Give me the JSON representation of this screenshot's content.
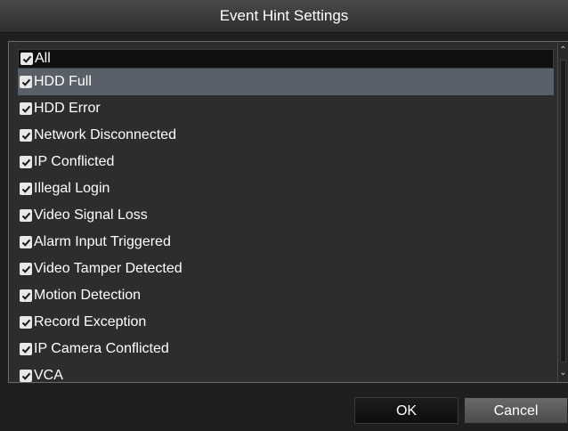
{
  "dialog": {
    "title": "Event Hint Settings"
  },
  "list": {
    "all_label": "All",
    "items": [
      {
        "label": "HDD Full",
        "checked": true,
        "selected": true
      },
      {
        "label": "HDD Error",
        "checked": true,
        "selected": false
      },
      {
        "label": "Network Disconnected",
        "checked": true,
        "selected": false
      },
      {
        "label": "IP Conflicted",
        "checked": true,
        "selected": false
      },
      {
        "label": "Illegal Login",
        "checked": true,
        "selected": false
      },
      {
        "label": "Video Signal Loss",
        "checked": true,
        "selected": false
      },
      {
        "label": "Alarm Input Triggered",
        "checked": true,
        "selected": false
      },
      {
        "label": "Video Tamper Detected",
        "checked": true,
        "selected": false
      },
      {
        "label": "Motion Detection",
        "checked": true,
        "selected": false
      },
      {
        "label": "Record Exception",
        "checked": true,
        "selected": false
      },
      {
        "label": "IP Camera Conflicted",
        "checked": true,
        "selected": false
      },
      {
        "label": "VCA",
        "checked": true,
        "selected": false
      }
    ]
  },
  "buttons": {
    "ok_label": "OK",
    "cancel_label": "Cancel"
  },
  "icons": {
    "checkbox": "checkbox-checked-icon",
    "scroll_up": "chevron-up-icon",
    "scroll_down": "chevron-down-icon"
  },
  "colors": {
    "background": "#1f1f1f",
    "selected_row": "#5a6069",
    "text": "#ffffff"
  }
}
